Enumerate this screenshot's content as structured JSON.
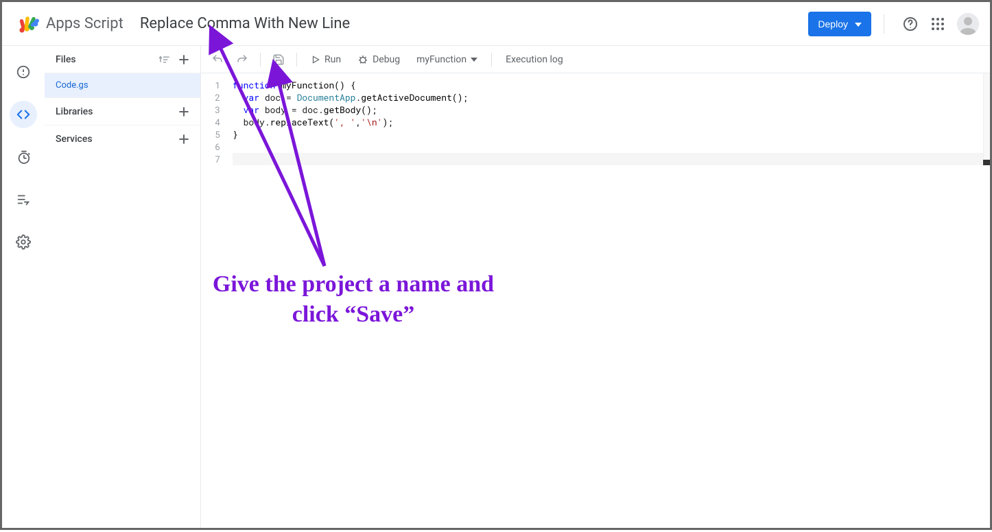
{
  "header": {
    "app_name": "Apps Script",
    "project_title": "Replace Comma With New Line",
    "deploy_label": "Deploy"
  },
  "rail": {
    "items": [
      "overview",
      "editor",
      "triggers",
      "executions",
      "settings"
    ]
  },
  "side_panel": {
    "files_label": "Files",
    "file_name": "Code.gs",
    "libraries_label": "Libraries",
    "services_label": "Services"
  },
  "toolbar": {
    "run_label": "Run",
    "debug_label": "Debug",
    "func_selector": "myFunction",
    "execlog_label": "Execution log"
  },
  "code": {
    "lines": [
      "function myFunction() {",
      "  var doc = DocumentApp.getActiveDocument();",
      "  var body = doc.getBody();",
      "  body.replaceText(', ','\\n');",
      "}",
      "",
      ""
    ]
  },
  "annotation": {
    "text": "Give the project a name and click “Save”"
  }
}
